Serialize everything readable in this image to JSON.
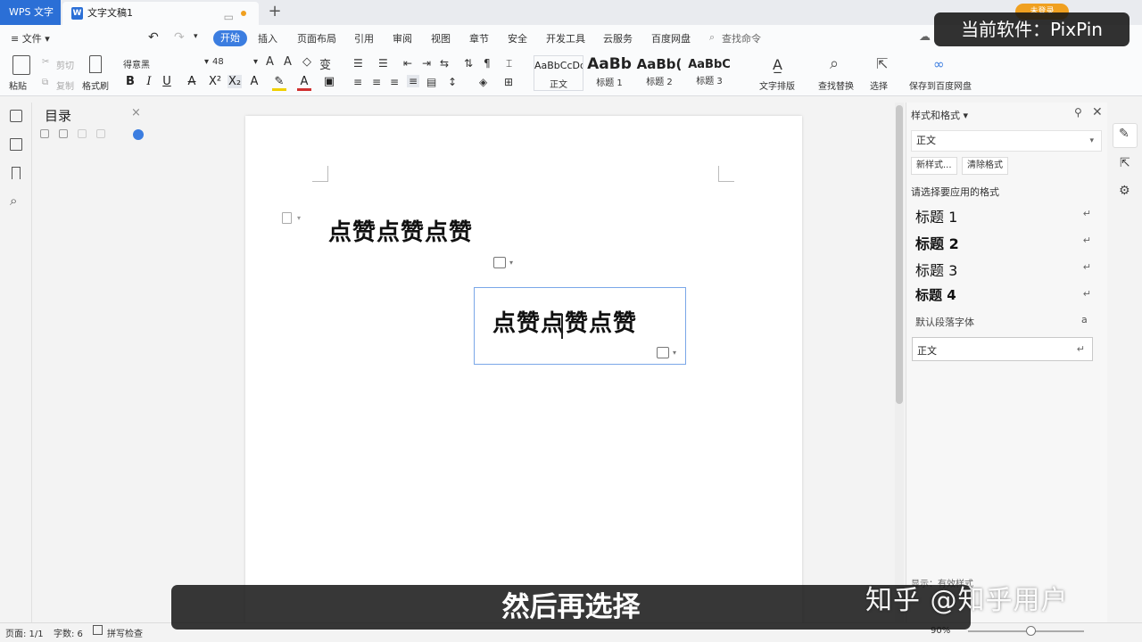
{
  "titlebar": {
    "app_tab": "WPS 文字",
    "doc_tab": "文字文稿1",
    "login_badge": "未登录"
  },
  "menu": {
    "file": "≡ 文件 ▾",
    "tabs": [
      "开始",
      "插入",
      "页面布局",
      "引用",
      "审阅",
      "视图",
      "章节",
      "安全",
      "开发工具",
      "云服务",
      "百度网盘"
    ],
    "search": "查找命令"
  },
  "ribbon": {
    "paste": "粘贴",
    "cut": "剪切",
    "copy": "复制",
    "format_painter": "格式刷",
    "font_name": "得意黑",
    "font_size": "48",
    "styles": [
      {
        "preview": "AaBbCcDd",
        "name": "正文"
      },
      {
        "preview": "AaBb",
        "name": "标题 1"
      },
      {
        "preview": "AaBb(",
        "name": "标题 2"
      },
      {
        "preview": "AaBbC",
        "name": "标题 3"
      }
    ],
    "text_layout": "文字排版",
    "find_replace": "查找替换",
    "select": "选择",
    "save_baidu": "保存到百度网盘"
  },
  "outline": {
    "title": "目录"
  },
  "document": {
    "line1": "点赞点赞点赞",
    "textbox_text": "点赞点赞点赞"
  },
  "styles_panel": {
    "title": "样式和格式 ▾",
    "current": "正文",
    "new_style": "新样式...",
    "clear_format": "清除格式",
    "hint": "请选择要应用的格式",
    "items": [
      "标题  1",
      "标题  2",
      "标题  3",
      "标题  4"
    ],
    "default_font": "默认段落字体",
    "current_item": "正文",
    "show_label": "显示：有效样式"
  },
  "statusbar": {
    "page": "页面: 1/1",
    "words": "字数: 6",
    "spellcheck": "拼写检查",
    "zoom": "90%"
  },
  "overlay": {
    "watermark": "当前软件：PixPin",
    "subtitle": "然后再选择",
    "zhihu": "知乎 @知乎用户"
  },
  "colors": {
    "accent": "#3b7de0",
    "app_tab": "#2b6fd6",
    "textbox_border": "#7aa7e8"
  }
}
